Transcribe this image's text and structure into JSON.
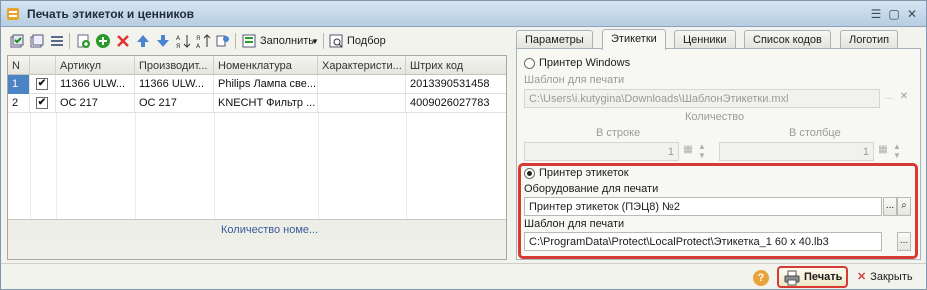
{
  "window": {
    "title": "Печать этикеток и ценников"
  },
  "toolbar": {
    "fill_label": "Заполнить",
    "select_label": "Подбор"
  },
  "grid": {
    "columns": [
      "N",
      "",
      "Артикул",
      "Производит...",
      "Номенклатура",
      "Характеристи...",
      "Штрих код"
    ],
    "rows": [
      {
        "n": "1",
        "checked": "✔",
        "article": "11366 ULW...",
        "maker": "11366 ULW...",
        "nomenclature": "Philips Лампа све...",
        "characteristic": "",
        "barcode": "2013390531458"
      },
      {
        "n": "2",
        "checked": "✔",
        "article": "OC 217",
        "maker": "OC 217",
        "nomenclature": "KNECHT Фильтр ...",
        "characteristic": "",
        "barcode": "4009026027783"
      }
    ],
    "footer": "Количество номе..."
  },
  "tabs": [
    "Параметры",
    "Этикетки",
    "Ценники",
    "Список кодов",
    "Логотип"
  ],
  "labels_panel": {
    "printer_windows": "Принтер Windows",
    "template_label": "Шаблон для печати",
    "template_path": "C:\\Users\\i.kutygina\\Downloads\\ШаблонЭтикетки.mxl",
    "quantity_label": "Количество",
    "in_row_label": "В строке",
    "in_col_label": "В столбце",
    "in_row_value": "1",
    "in_col_value": "1",
    "label_printer": "Принтер этикеток",
    "equipment_label": "Оборудование для печати",
    "equipment_value": "Принтер этикеток (ПЭЦ8) №2",
    "template2_label": "Шаблон для печати",
    "template2_value": "C:\\ProgramData\\Protect\\LocalProtect\\Этикетка_1 60 x 40.lb3"
  },
  "bottom": {
    "help": "?",
    "print": "Печать",
    "close": "Закрыть"
  }
}
